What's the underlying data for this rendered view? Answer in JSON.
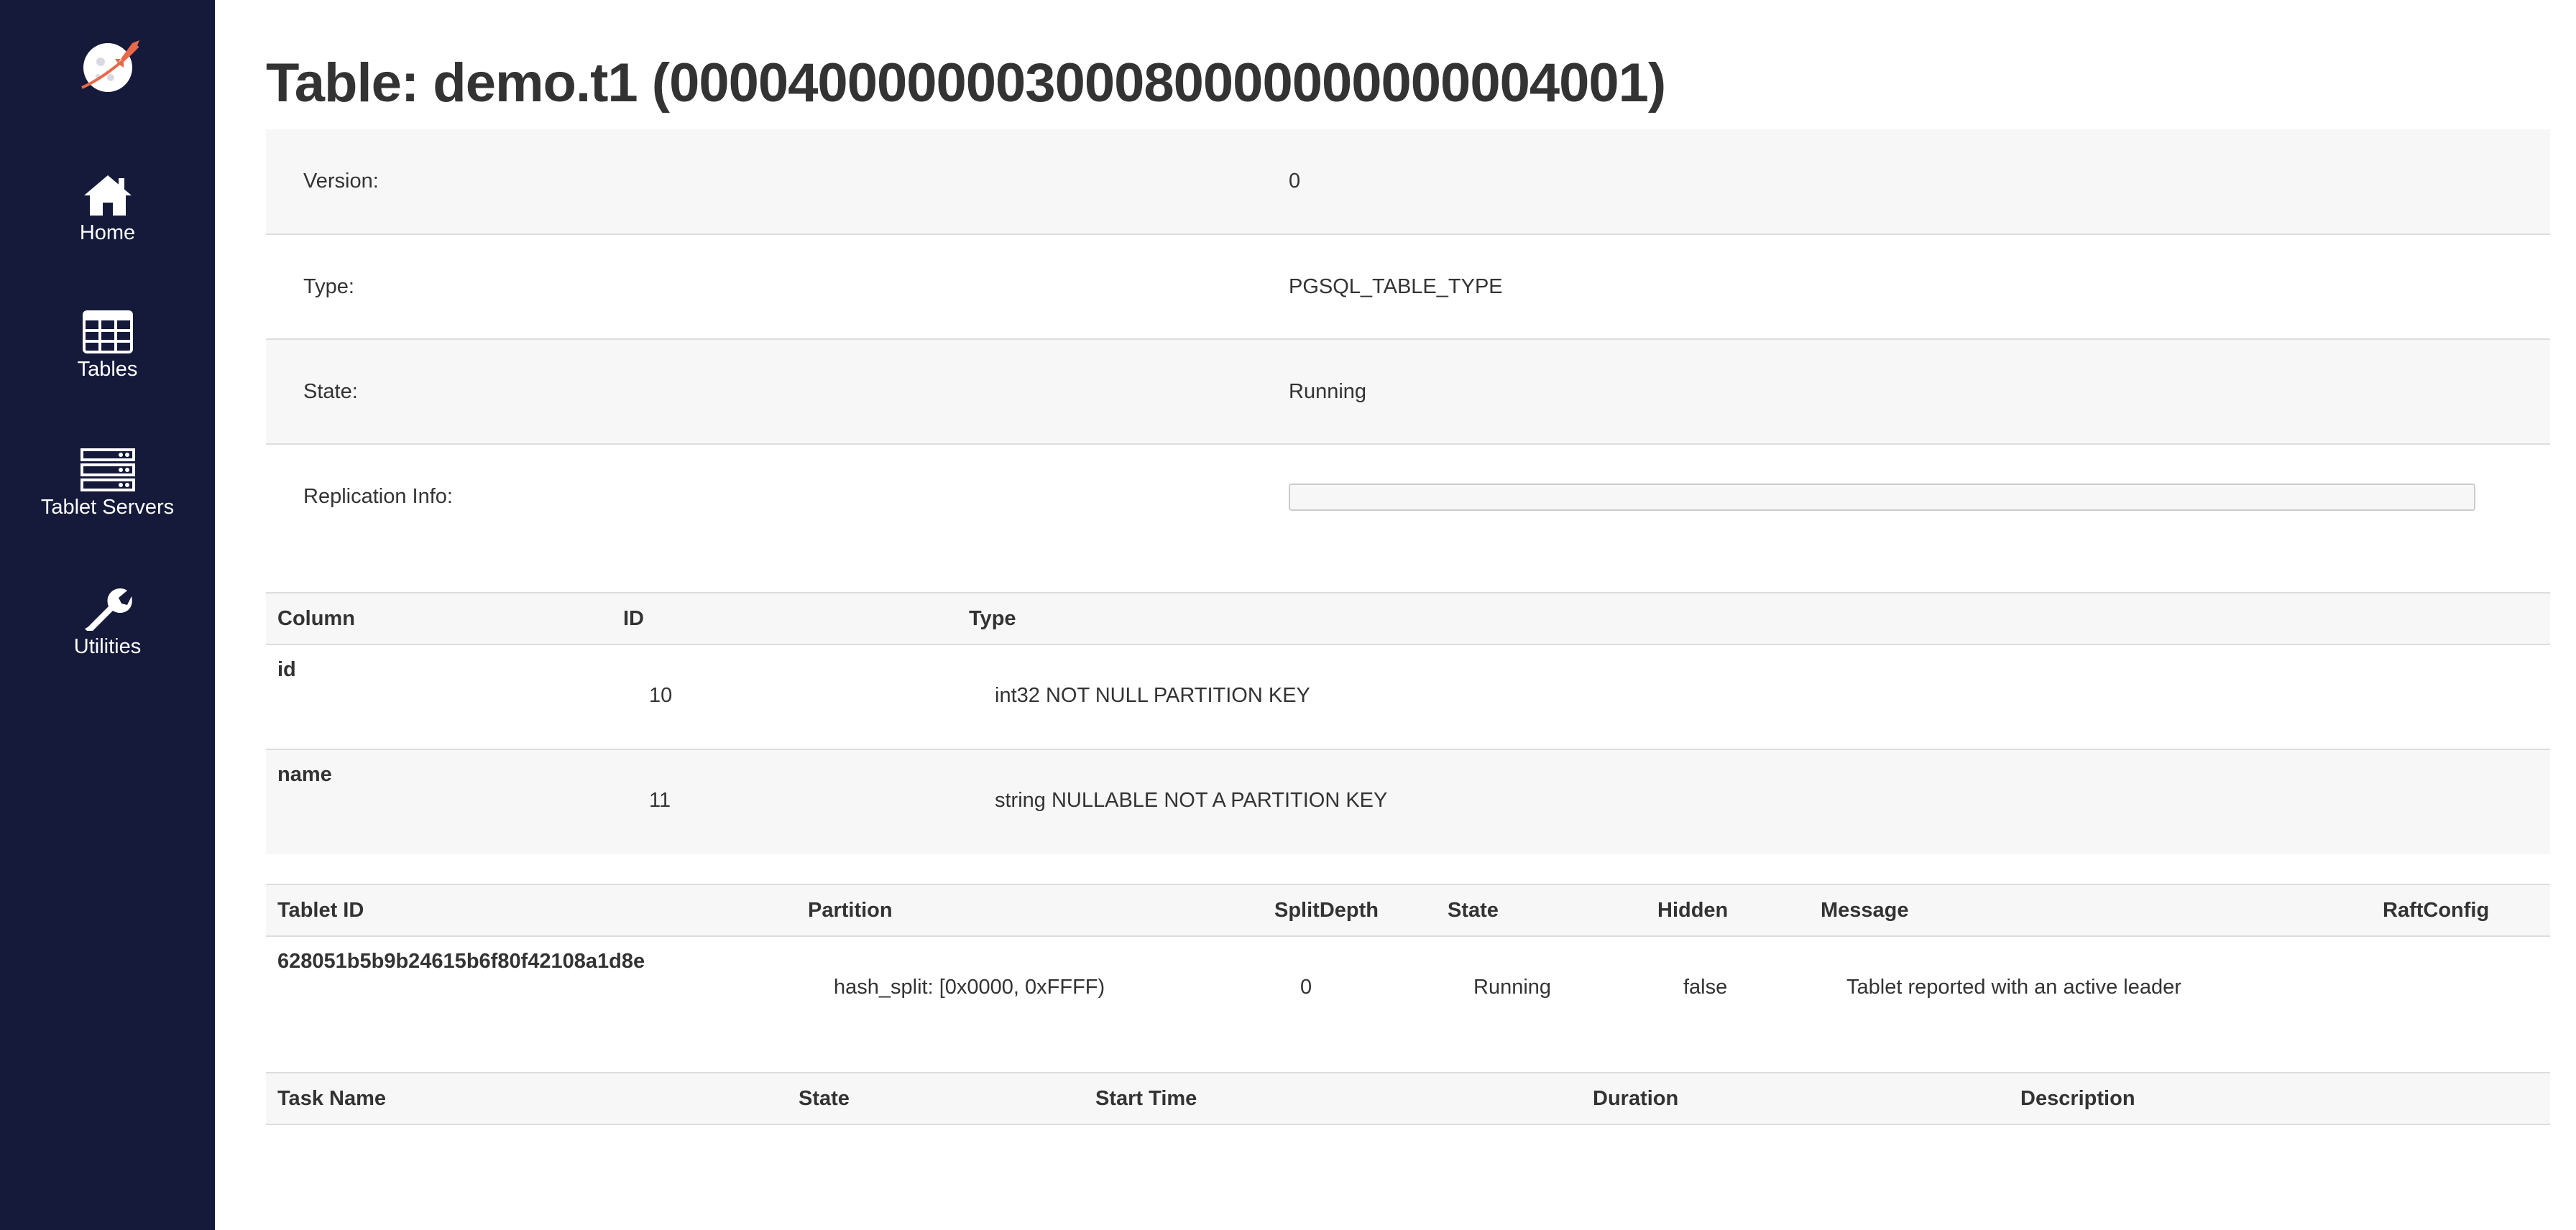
{
  "nav": {
    "items": [
      {
        "label": "Home",
        "icon": "home-icon"
      },
      {
        "label": "Tables",
        "icon": "table-grid-icon"
      },
      {
        "label": "Tablet Servers",
        "icon": "server-stack-icon"
      },
      {
        "label": "Utilities",
        "icon": "wrench-icon"
      }
    ]
  },
  "page": {
    "title": "Table: demo.t1 (000040000000300080000000000004001)"
  },
  "info": {
    "version_label": "Version:",
    "version_value": "0",
    "type_label": "Type:",
    "type_value": "PGSQL_TABLE_TYPE",
    "state_label": "State:",
    "state_value": "Running",
    "replication_label": "Replication Info:",
    "replication_value": ""
  },
  "columns_table": {
    "headers": [
      "Column",
      "ID",
      "Type"
    ],
    "rows": [
      {
        "column": "id",
        "id": "10",
        "type": "int32 NOT NULL PARTITION KEY"
      },
      {
        "column": "name",
        "id": "11",
        "type": "string NULLABLE NOT A PARTITION KEY"
      }
    ]
  },
  "tablets_table": {
    "headers": [
      "Tablet ID",
      "Partition",
      "SplitDepth",
      "State",
      "Hidden",
      "Message",
      "RaftConfig"
    ],
    "rows": [
      {
        "tablet_id": "628051b5b9b24615b6f80f42108a1d8e",
        "partition": "hash_split: [0x0000, 0xFFFF)",
        "split_depth": "0",
        "state": "Running",
        "hidden": "false",
        "message": "Tablet reported with an active leader",
        "raft_config": ""
      }
    ]
  },
  "tasks_table": {
    "headers": [
      "Task Name",
      "State",
      "Start Time",
      "Duration",
      "Description"
    ]
  },
  "colors": {
    "sidebar_bg": "#151a3a",
    "logo_accent": "#e8684a",
    "stripe": "#f7f7f7",
    "border": "#dddddd",
    "text": "#333333"
  }
}
